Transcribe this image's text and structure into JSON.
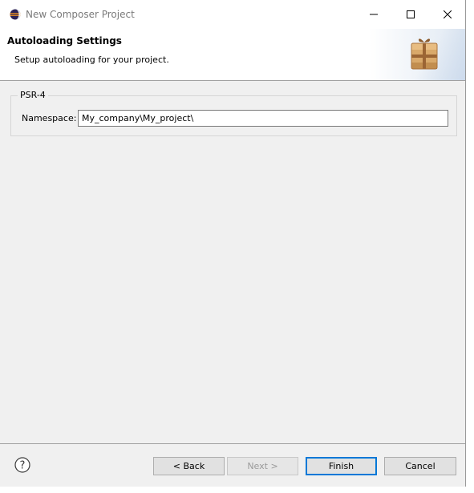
{
  "window": {
    "title": "New Composer Project"
  },
  "banner": {
    "title": "Autoloading Settings",
    "description": "Setup autoloading for your project."
  },
  "psr4": {
    "group_label": "PSR-4",
    "namespace_label": "Namespace:",
    "namespace_value": "My_company\\My_project\\"
  },
  "footer": {
    "help_label": "?",
    "back_label": "< Back",
    "next_label": "Next >",
    "finish_label": "Finish",
    "cancel_label": "Cancel"
  },
  "colors": {
    "accent": "#0078d7",
    "dialog_bg": "#f0f0f0",
    "banner_bg": "#ffffff"
  },
  "icons": {
    "app": "eclipse-icon",
    "banner": "package-icon",
    "help": "help-icon"
  }
}
